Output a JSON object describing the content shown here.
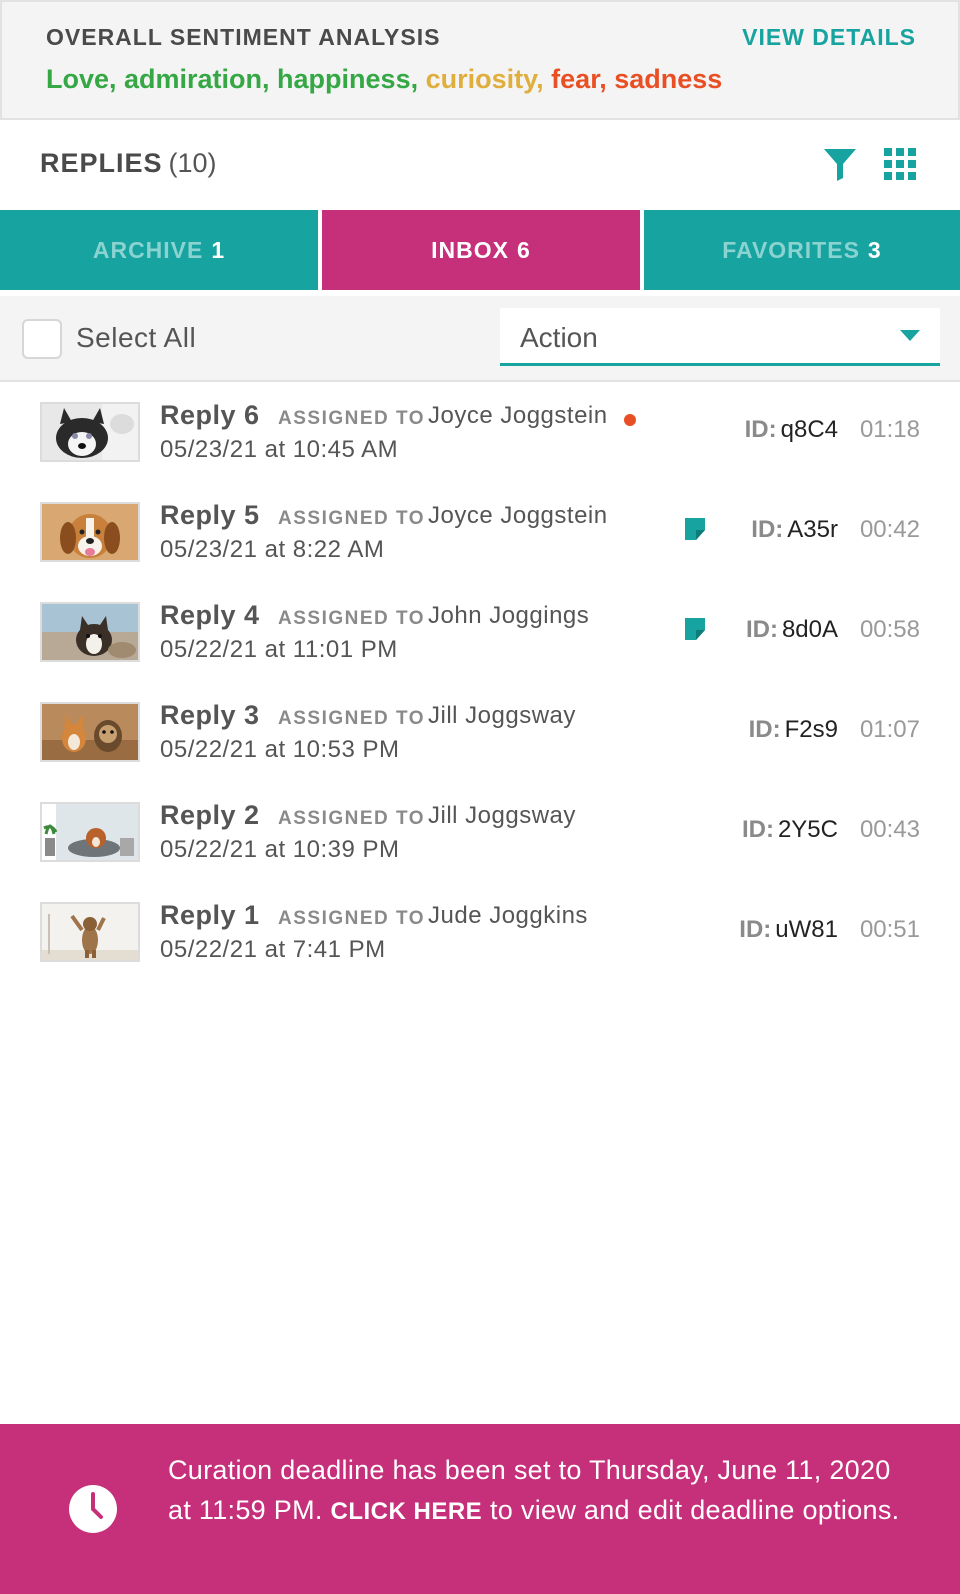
{
  "sentiment": {
    "title": "OVERALL SENTIMENT ANALYSIS",
    "view_details": "VIEW DETAILS",
    "positive": "Love, admiration, happiness,",
    "neutral": "curiosity,",
    "negative": "fear, sadness",
    "colors": {
      "positive": "#35a845",
      "neutral": "#e0ae3c",
      "negative": "#e94f25"
    }
  },
  "replies_header": {
    "title": "REPLIES",
    "count": "(10)",
    "filter_icon": "filter-icon",
    "grid_icon": "grid-view-icon"
  },
  "tabs": [
    {
      "label": "ARCHIVE",
      "count": "1",
      "active": false
    },
    {
      "label": "INBOX",
      "count": "6",
      "active": true
    },
    {
      "label": "FAVORITES",
      "count": "3",
      "active": false
    }
  ],
  "toolbar": {
    "select_all": "Select All",
    "action": "Action"
  },
  "replies": [
    {
      "name": "Reply 6",
      "assigned_label": "ASSIGNED TO",
      "assignee": "Joyce Joggstein",
      "date": "05/23/21 at 10:45 AM",
      "id_label": "ID:",
      "id": "q8C4",
      "duration": "01:18",
      "unread": true,
      "has_note": false,
      "thumb": "husky"
    },
    {
      "name": "Reply 5",
      "assigned_label": "ASSIGNED TO",
      "assignee": "Joyce Joggstein",
      "date": "05/23/21 at 8:22 AM",
      "id_label": "ID:",
      "id": "A35r",
      "duration": "00:42",
      "unread": false,
      "has_note": true,
      "thumb": "beagle"
    },
    {
      "name": "Reply 4",
      "assigned_label": "ASSIGNED TO",
      "assignee": "John Joggings",
      "date": "05/22/21 at 11:01 PM",
      "id_label": "ID:",
      "id": "8d0A",
      "duration": "00:58",
      "unread": false,
      "has_note": true,
      "thumb": "collie"
    },
    {
      "name": "Reply 3",
      "assigned_label": "ASSIGNED TO",
      "assignee": "Jill Joggsway",
      "date": "05/22/21 at 10:53 PM",
      "id_label": "ID:",
      "id": "F2s9",
      "duration": "01:07",
      "unread": false,
      "has_note": false,
      "thumb": "corgi"
    },
    {
      "name": "Reply 2",
      "assigned_label": "ASSIGNED TO",
      "assignee": "Jill Joggsway",
      "date": "05/22/21 at 10:39 PM",
      "id_label": "ID:",
      "id": "2Y5C",
      "duration": "00:43",
      "unread": false,
      "has_note": false,
      "thumb": "bed"
    },
    {
      "name": "Reply 1",
      "assigned_label": "ASSIGNED TO",
      "assignee": "Jude Joggkins",
      "date": "05/22/21 at 7:41 PM",
      "id_label": "ID:",
      "id": "uW81",
      "duration": "00:51",
      "unread": false,
      "has_note": false,
      "thumb": "standing"
    }
  ],
  "banner": {
    "text_before": "Curation deadline has been set to Thursday, June 11, 2020 at 11:59 PM.",
    "link": "CLICK HERE",
    "text_after": "to view and edit deadline options.",
    "icon": "clock-icon"
  }
}
